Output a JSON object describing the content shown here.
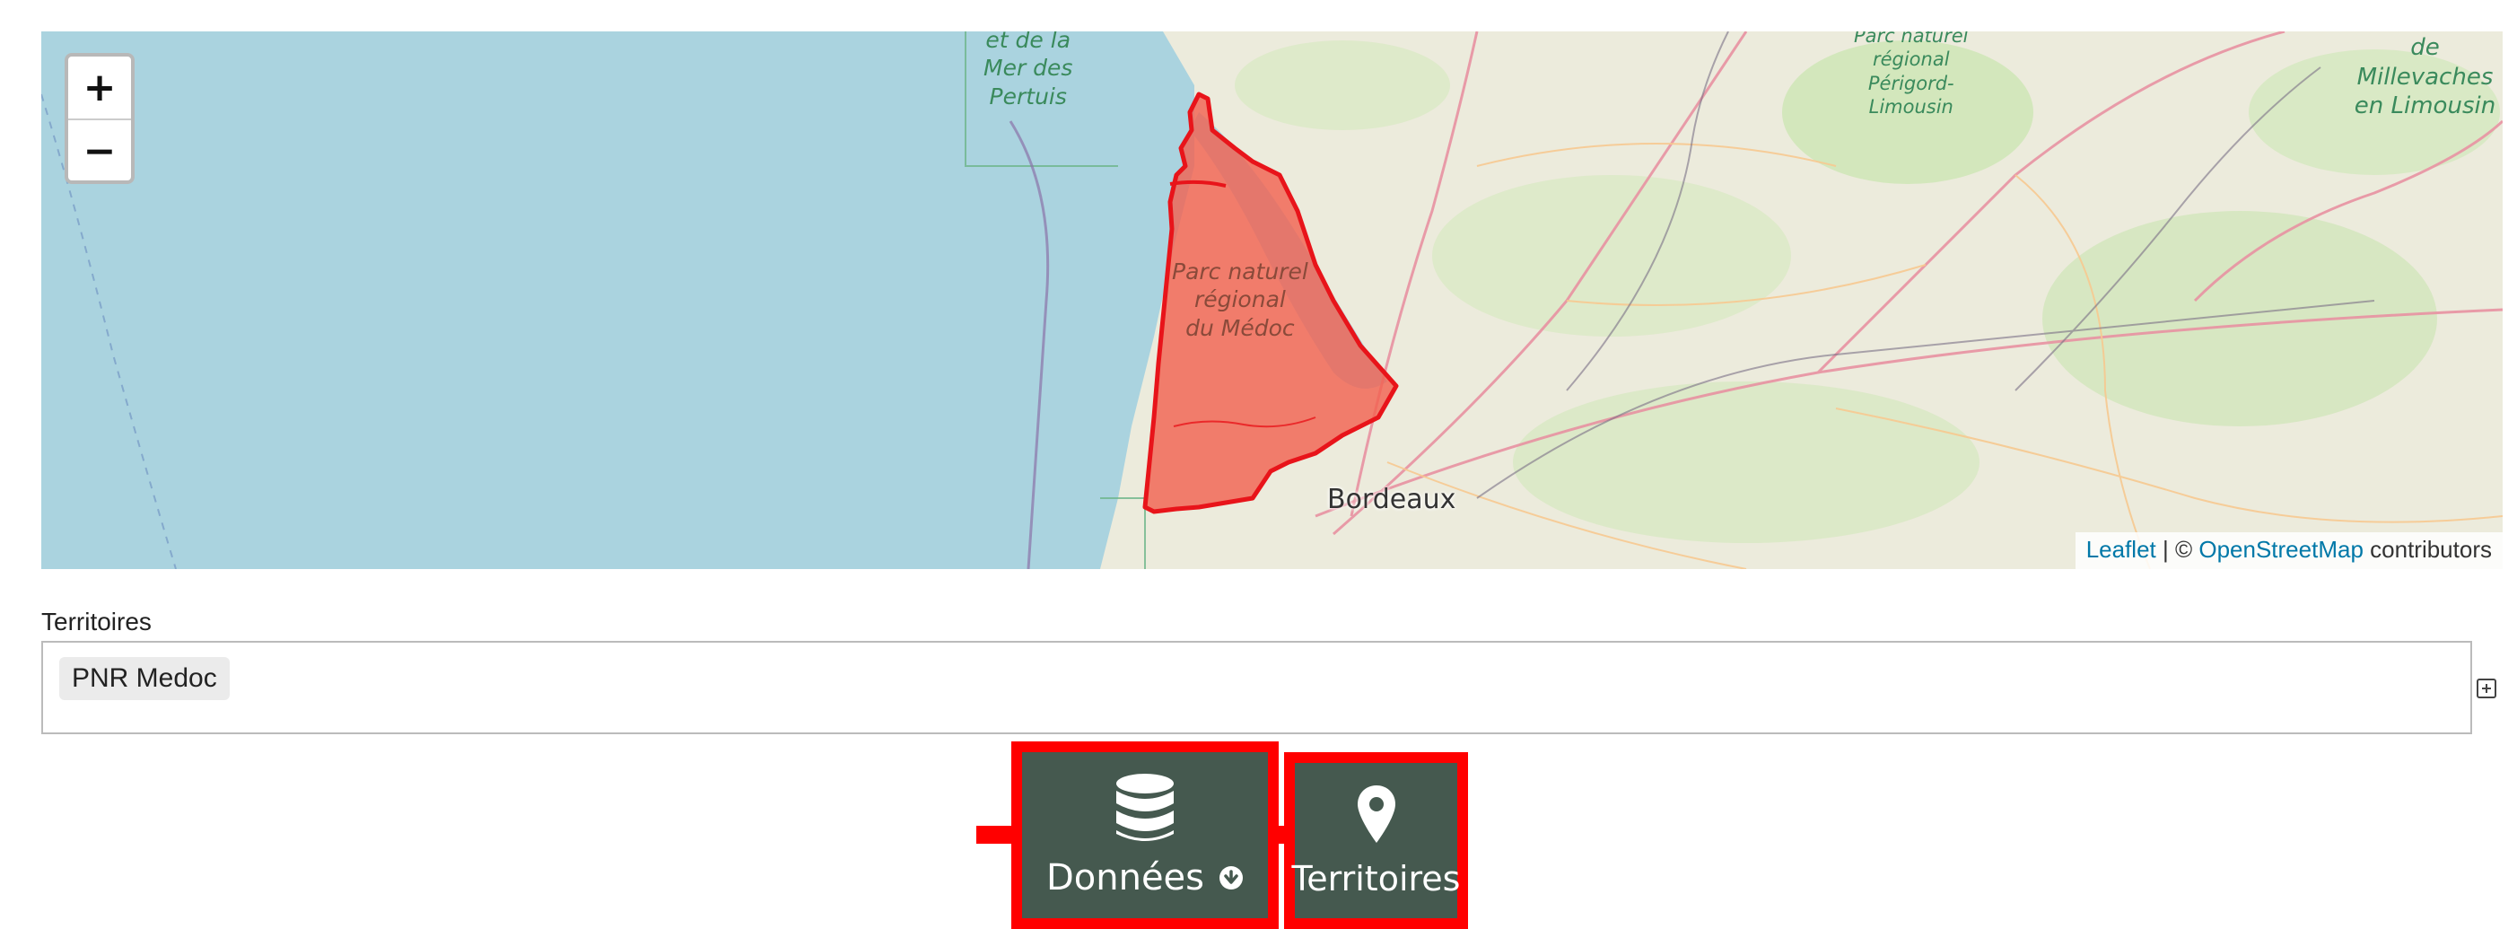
{
  "map": {
    "zoom_in": "+",
    "zoom_out": "−",
    "attribution": {
      "leaflet": "Leaflet",
      "separator": " | © ",
      "osm": "OpenStreetMap",
      "suffix": " contributors"
    },
    "labels": {
      "mer_des_pertuis": "et de la\nMer des\nPertuis",
      "pnr_perigord": "Parc naturel\nrégional\nPérigord-\nLimousin",
      "millevaches": "de Millevaches\nen Limousin",
      "pnr_medoc": "Parc naturel\nrégional\ndu Médoc",
      "bordeaux": "Bordeaux"
    },
    "polygon_color": "#f2604f",
    "polygon_stroke": "#e8141a"
  },
  "territoires_field": {
    "label": "Territoires",
    "selected": [
      "PNR Medoc"
    ]
  },
  "nav": {
    "donnees": {
      "label": "Données",
      "icon": "database-icon"
    },
    "territoires": {
      "label": "Territoires",
      "icon": "map-marker-icon"
    },
    "highlight_color": "#ff0000",
    "button_color": "#45594f"
  }
}
